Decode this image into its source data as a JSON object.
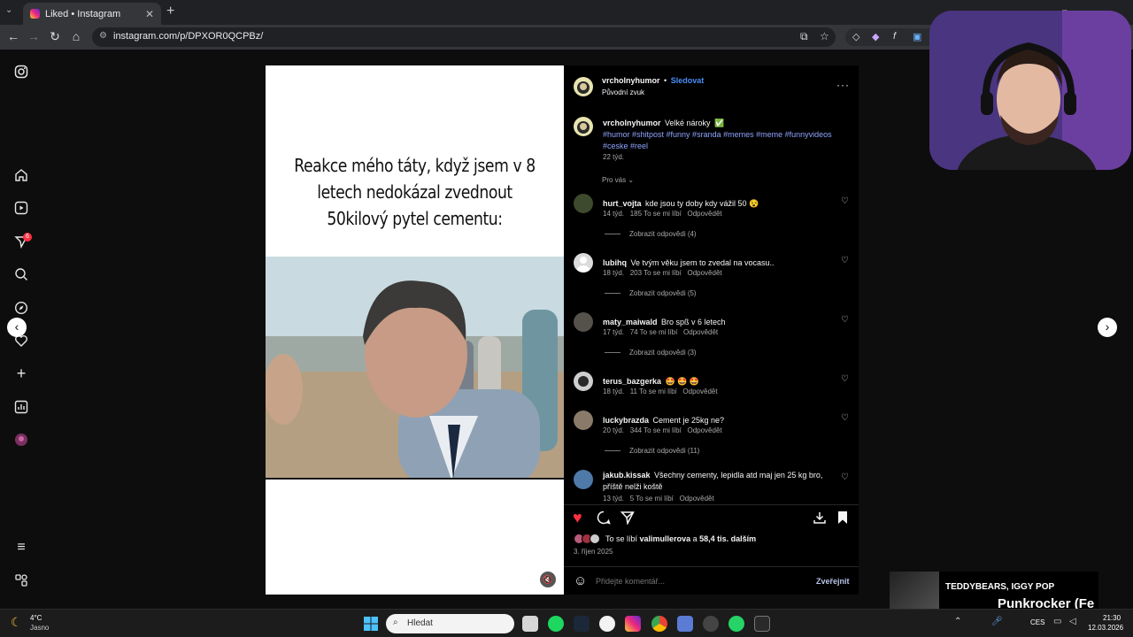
{
  "browser": {
    "tab_title": "Liked • Instagram",
    "tab_close": "✕",
    "new_tab": "+",
    "url": "instagram.com/p/DPXOR0QCPBz/"
  },
  "sidebar": {
    "notifications_badge": "6"
  },
  "post": {
    "media_text": "Reakce mého táty, když jsem v 8 letech nedokázal zvednout 50kilový pytel cementu:",
    "author": "vrcholnyhumor",
    "dot": "•",
    "follow": "Sledovat",
    "audio": "Původní zvuk",
    "caption": "Velké nároky",
    "caption_emoji": "✅",
    "hashtags": "#humor #shitpost #funny #sranda #memes #meme #funnyvideos #ceske #reel",
    "caption_age": "22 týd.",
    "sort": "Pro vás",
    "likes_prefix": "To se líbí",
    "likes_user": "valimullerova",
    "likes_mid": "a",
    "likes_rest": "58,4 tis. dalším",
    "date": "3. říjen 2025",
    "add_comment_placeholder": "Přidejte komentář...",
    "publish": "Zveřejnit"
  },
  "comments": [
    {
      "user": "hurt_vojta",
      "text": "kde jsou ty doby kdy vážil 50 😵",
      "age": "14 týd.",
      "likes": "185 To se mi líbí",
      "reply": "Odpovědět",
      "replies": "Zobrazit odpovědi (4)"
    },
    {
      "user": "lubihq",
      "text": "Ve tvým věku jsem to zvedal na vocasu..",
      "age": "18 týd.",
      "likes": "203 To se mi líbí",
      "reply": "Odpovědět",
      "replies": "Zobrazit odpovědi (5)"
    },
    {
      "user": "maty_maiwald",
      "text": "Bro spß v 6 letech",
      "age": "17 týd.",
      "likes": "74 To se mi líbí",
      "reply": "Odpovědět",
      "replies": "Zobrazit odpovědi (3)"
    },
    {
      "user": "terus_bazgerka",
      "text": "🤩 🤩 🤩",
      "age": "18 týd.",
      "likes": "11 To se mi líbí",
      "reply": "Odpovědět",
      "replies": ""
    },
    {
      "user": "luckybrazda",
      "text": "Cement je 25kg ne?",
      "age": "20 týd.",
      "likes": "344 To se mi líbí",
      "reply": "Odpovědět",
      "replies": "Zobrazit odpovědi (11)"
    },
    {
      "user": "jakub.kissak",
      "text": "Všechny cementy, lepidla atd maj jen 25 kg bro, příště nelži koště",
      "age": "13 týd.",
      "likes": "5 To se mi líbí",
      "reply": "Odpovědět",
      "replies": ""
    }
  ],
  "overlay": {
    "music_artist": "TEDDYBEARS, IGGY POP",
    "music_title": "Punkrocker (Fe"
  },
  "taskbar": {
    "weather_temp": "4°C",
    "weather_desc": "Jasno",
    "search_placeholder": "Hledat",
    "lang": "CES",
    "time": "21:30",
    "date": "12.03.2026"
  },
  "colors": {
    "like_red": "#ff3040",
    "link_blue": "#8ea5ff",
    "follow_blue": "#4a8df8"
  }
}
